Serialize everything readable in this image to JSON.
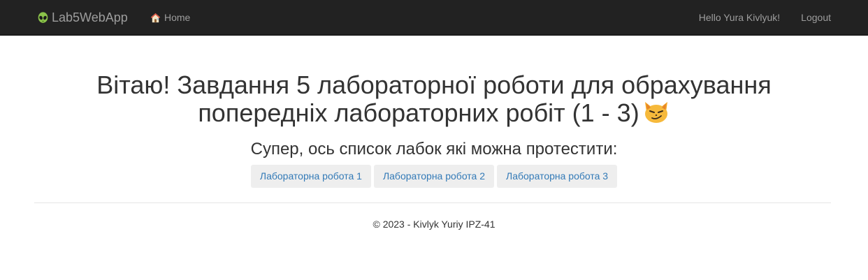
{
  "navbar": {
    "brand": "Lab5WebApp",
    "home_label": "Home",
    "greeting": "Hello Yura Kivlyuk!",
    "logout_label": "Logout"
  },
  "main": {
    "title": "Вітаю! Завдання 5 лабораторної роботи для обрахування попередніх лабораторних робіт (1 - 3)",
    "subtitle": "Супер, ось список лабок які можна протестити:",
    "buttons": [
      "Лабораторна робота 1",
      "Лабораторна робота 2",
      "Лабораторна робота 3"
    ]
  },
  "footer": {
    "text": "© 2023 - Kivlyk Yuriy IPZ-41"
  },
  "icons": {
    "brand": "alien-icon",
    "home": "house-icon",
    "title_emoji": "smirking-cat-icon"
  },
  "colors": {
    "navbar_bg": "#222222",
    "nav_text": "#9d9d9d",
    "link": "#337ab7",
    "button_bg": "#eeeeee"
  }
}
